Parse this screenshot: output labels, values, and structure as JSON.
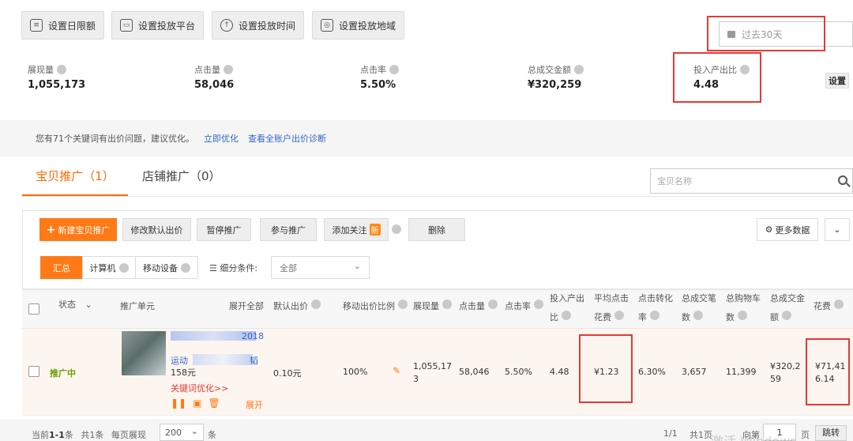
{
  "toolbar": {
    "buttons": [
      {
        "label": "设置日限额"
      },
      {
        "label": "设置投放平台"
      },
      {
        "label": "设置投放时间"
      },
      {
        "label": "设置投放地域"
      }
    ]
  },
  "date_range": {
    "label": "过去30天"
  },
  "metrics": [
    {
      "label": "展现量",
      "value": "1,055,173"
    },
    {
      "label": "点击量",
      "value": "58,046"
    },
    {
      "label": "点击率",
      "value": "5.50%"
    },
    {
      "label": "总成交金额",
      "value": "¥320,259"
    },
    {
      "label": "投入产出比",
      "value": "4.48"
    }
  ],
  "settings_label": "设置",
  "notice": {
    "text": "您有71个关键词有出价问题，建议优化。",
    "link1": "立即优化",
    "link2": "查看全账户出价诊断"
  },
  "tabs": [
    {
      "label": "宝贝推广（1）"
    },
    {
      "label": "店铺推广（0）"
    }
  ],
  "search": {
    "placeholder": "宝贝名称"
  },
  "actions": {
    "new_promo": "新建宝贝推广",
    "edit_bid": "修改默认出价",
    "pause": "暂停推广",
    "join": "参与推广",
    "add_follow": "添加关注",
    "new_badge": "新",
    "delete": "删除",
    "more_data": "更多数据"
  },
  "segments": {
    "all": "汇总",
    "pc": "计算机",
    "mobile": "移动设备",
    "filter_label": "细分条件:",
    "filter_value": "全部"
  },
  "columns": {
    "status": "状态",
    "unit": "推广单元",
    "expand_all": "展开全部",
    "default_bid": "默认出价",
    "mobile_ratio": "移动出价比例",
    "impressions": "展现量",
    "clicks": "点击量",
    "ctr": "点击率",
    "roi_1": "投入产出",
    "roi_2": "比",
    "avg_cpc_1": "平均点击",
    "avg_cpc_2": "花费",
    "conv_1": "点击转化",
    "conv_2": "率",
    "orders_1": "总成交笔",
    "orders_2": "数",
    "cart_1": "总购物车",
    "cart_2": "数",
    "gmv_1": "总成交金",
    "gmv_2": "额",
    "cost": "花费"
  },
  "row": {
    "status": "推广中",
    "title_line1": "2018",
    "title_line2_a": "运动",
    "title_line2_b": "韬",
    "price": "158元",
    "keyword_opt": "关键词优化>>",
    "expand": "展开",
    "default_bid": "0.10元",
    "mobile_ratio": "100%",
    "impressions_1": "1,055,17",
    "impressions_2": "3",
    "clicks": "58,046",
    "ctr": "5.50%",
    "roi": "4.48",
    "avg_cpc": "¥1.23",
    "conv": "6.30%",
    "orders": "3,657",
    "cart": "11,399",
    "gmv_1": "¥320,2",
    "gmv_2": "59",
    "cost_1": "¥71,41",
    "cost_2": "6.14"
  },
  "pager": {
    "current": "当前",
    "range": "1-1",
    "unit": "条",
    "total_label": "共",
    "total": "1",
    "per_page_label": "每页展现",
    "per_page": "200",
    "page_info": "1/1",
    "total_pages": "共1页",
    "goto": "向第",
    "page_input": "1",
    "page_unit": "页",
    "jump": "跳转",
    "watermark": "激活 Windows"
  },
  "colors": {
    "accent": "#ff7a16",
    "link": "#3366cc",
    "status_green": "#66a000",
    "highlight": "#e53935"
  }
}
